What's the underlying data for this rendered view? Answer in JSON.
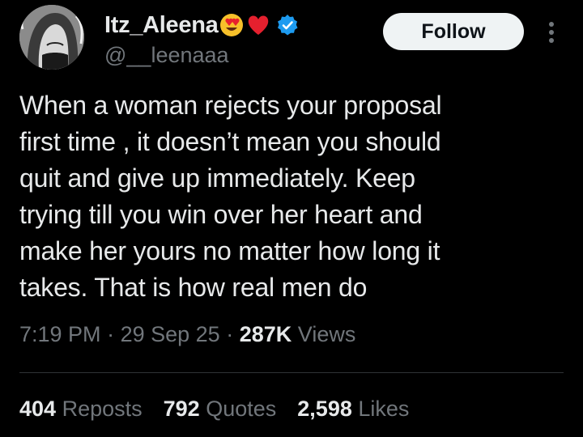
{
  "user": {
    "display_name": "Itz_Aleena",
    "handle": "@__leenaaa",
    "name_emojis": [
      "smiling-face-with-heart-eyes-icon",
      "red-heart-icon"
    ],
    "verified": true
  },
  "actions": {
    "follow_label": "Follow",
    "more_icon": "more-vertical-icon"
  },
  "tweet": {
    "text_lines": [
      "When a woman rejects your proposal",
      "first time , it doesn’t mean you should",
      "quit and give up immediately. Keep",
      "trying till you win over her heart and",
      "make her yours no matter how long it",
      "takes. That is how real men do"
    ],
    "time": "7:19 PM",
    "separator": "·",
    "date": "29 Sep 25",
    "views_count": "287K",
    "views_label": "Views"
  },
  "stats": {
    "reposts_count": "404",
    "reposts_label": "Reposts",
    "quotes_count": "792",
    "quotes_label": "Quotes",
    "likes_count": "2,598",
    "likes_label": "Likes"
  },
  "colors": {
    "background": "#000000",
    "text_primary": "#e7e9ea",
    "text_secondary": "#71767b",
    "follow_bg": "#eff3f4",
    "verified_blue": "#1d9bf0",
    "divider": "#2f3336"
  }
}
